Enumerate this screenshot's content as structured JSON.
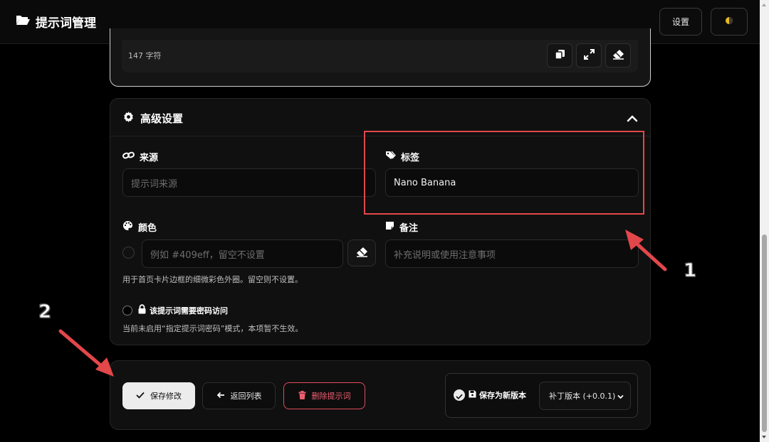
{
  "header": {
    "title": "提示词管理",
    "settings_label": "设置",
    "theme_icon": "contrast-icon"
  },
  "editor": {
    "char_count": "147 字符",
    "icons": [
      "copy-icon",
      "expand-icon",
      "eraser-icon"
    ]
  },
  "advanced": {
    "title": "高级设置",
    "source": {
      "label": "来源",
      "placeholder": "提示词来源",
      "value": ""
    },
    "tags": {
      "label": "标签",
      "value": "Nano Banana"
    },
    "color": {
      "label": "颜色",
      "placeholder": "例如 #409eff，留空不设置",
      "hint": "用于首页卡片边框的细微彩色外圈。留空则不设置。"
    },
    "note": {
      "label": "备注",
      "placeholder": "补充说明或使用注意事项"
    },
    "password": {
      "label": "该提示词需要密码访问",
      "hint": "当前未启用“指定提示词密码”模式，本项暂不生效。"
    }
  },
  "actions": {
    "save_label": "保存修改",
    "back_label": "返回列表",
    "delete_label": "删除提示词",
    "save_new_version_label": "保存为新版本",
    "version_select": "补丁版本 (+0.0.1)"
  },
  "annotations": {
    "one": "1",
    "two": "2"
  },
  "colors": {
    "accent_red": "#e2474a",
    "delete_red": "#ef5d70"
  }
}
